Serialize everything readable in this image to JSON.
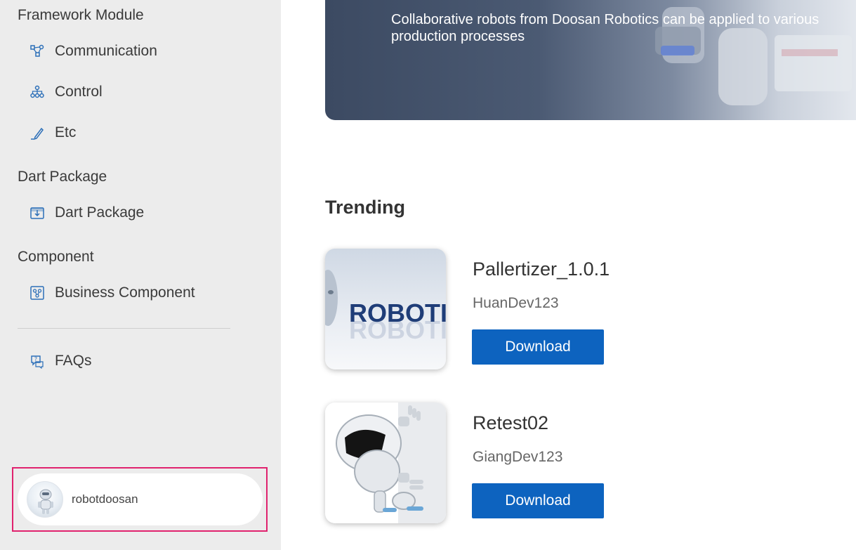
{
  "sidebar": {
    "sections": [
      {
        "title": "Framework Module",
        "items": [
          {
            "label": "Communication",
            "icon": "network-icon"
          },
          {
            "label": "Control",
            "icon": "hierarchy-icon"
          },
          {
            "label": "Etc",
            "icon": "pencil-icon"
          }
        ]
      },
      {
        "title": "Dart Package",
        "items": [
          {
            "label": "Dart Package",
            "icon": "package-icon"
          }
        ]
      },
      {
        "title": "Component",
        "items": [
          {
            "label": "Business Component",
            "icon": "component-icon"
          }
        ]
      }
    ],
    "faq_label": "FAQs",
    "user": {
      "name": "robotdoosan"
    }
  },
  "hero": {
    "line1": "Collaborative robots from Doosan Robotics can be applied to various",
    "line2": "production processes"
  },
  "trending": {
    "heading": "Trending",
    "thumb1_text": "ROBOTI",
    "items": [
      {
        "title": "Pallertizer_1.0.1",
        "author": "HuanDev123",
        "button": "Download"
      },
      {
        "title": "Retest02",
        "author": "GiangDev123",
        "button": "Download"
      }
    ]
  },
  "colors": {
    "accent": "#0d63bf",
    "sidebar_bg": "#ececec",
    "highlight": "#e0226e"
  }
}
